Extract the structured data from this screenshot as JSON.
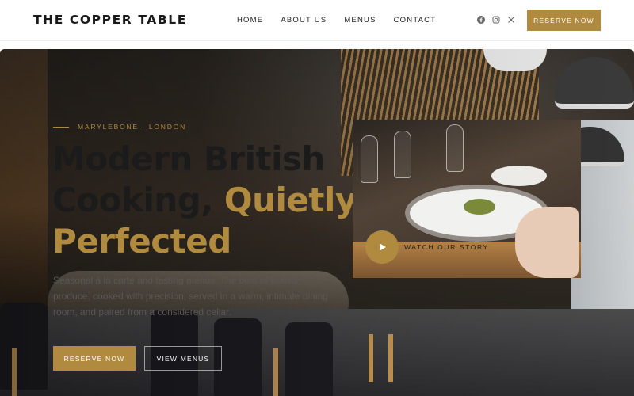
{
  "brand": {
    "name": "THE COPPER TABLE"
  },
  "nav": {
    "items": [
      {
        "label": "HOME"
      },
      {
        "label": "ABOUT US"
      },
      {
        "label": "MENUS"
      },
      {
        "label": "CONTACT"
      }
    ]
  },
  "social": {
    "icons": [
      "facebook-icon",
      "instagram-icon",
      "x-icon"
    ]
  },
  "header": {
    "reserve_label": "RESERVE NOW"
  },
  "hero": {
    "kicker": "MARYLEBONE · LONDON",
    "headline_line1": "Modern British",
    "headline_line2_dark": "Cooking, ",
    "headline_line2_gold": "Quietly",
    "headline_line3_gold": "Perfected",
    "intro": "Seasonal à la carte and tasting menus. The best of British produce, cooked with precision, served in a warm, intimate dining room, and paired from a considered cellar.",
    "primary_button": "RESERVE NOW",
    "secondary_button": "VIEW MENUS"
  },
  "video": {
    "label": "WATCH OUR STORY"
  },
  "colors": {
    "accent": "#b08a3e",
    "dark": "#1b1b1b"
  }
}
